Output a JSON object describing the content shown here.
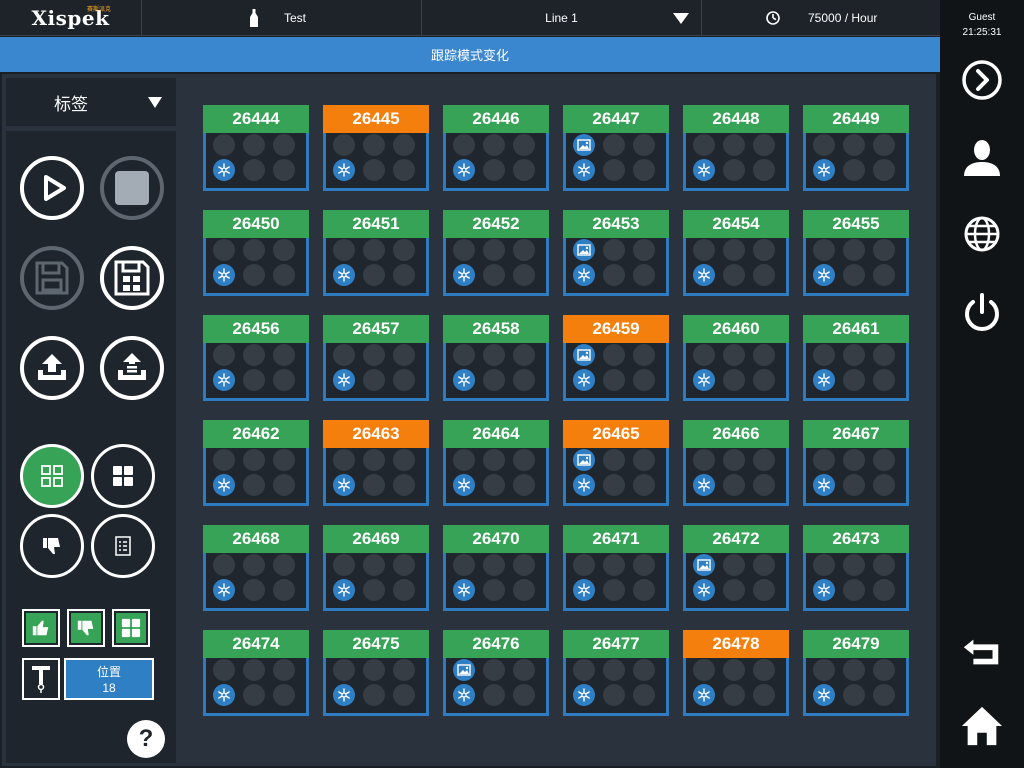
{
  "header": {
    "logo": "Xispek",
    "logo_sub": "赛斯派克",
    "product": "Test",
    "line": "Line 1",
    "speed": "75000 / Hour"
  },
  "banner": "跟踪模式变化",
  "user": {
    "name": "Guest",
    "time": "21:25:31"
  },
  "sidebar": {
    "dropdown_label": "标签",
    "position_label": "位置",
    "position_value": "18",
    "help": "?"
  },
  "colors": {
    "ok": "#36a356",
    "alarm": "#f57f0c",
    "accent": "#2f7fc5"
  },
  "tiles": [
    {
      "id": "26444",
      "alarm": false,
      "image": false
    },
    {
      "id": "26445",
      "alarm": true,
      "image": false
    },
    {
      "id": "26446",
      "alarm": false,
      "image": false
    },
    {
      "id": "26447",
      "alarm": false,
      "image": true
    },
    {
      "id": "26448",
      "alarm": false,
      "image": false
    },
    {
      "id": "26449",
      "alarm": false,
      "image": false
    },
    {
      "id": "26450",
      "alarm": false,
      "image": false
    },
    {
      "id": "26451",
      "alarm": false,
      "image": false
    },
    {
      "id": "26452",
      "alarm": false,
      "image": false
    },
    {
      "id": "26453",
      "alarm": false,
      "image": true
    },
    {
      "id": "26454",
      "alarm": false,
      "image": false
    },
    {
      "id": "26455",
      "alarm": false,
      "image": false
    },
    {
      "id": "26456",
      "alarm": false,
      "image": false
    },
    {
      "id": "26457",
      "alarm": false,
      "image": false
    },
    {
      "id": "26458",
      "alarm": false,
      "image": false
    },
    {
      "id": "26459",
      "alarm": true,
      "image": true
    },
    {
      "id": "26460",
      "alarm": false,
      "image": false
    },
    {
      "id": "26461",
      "alarm": false,
      "image": false
    },
    {
      "id": "26462",
      "alarm": false,
      "image": false
    },
    {
      "id": "26463",
      "alarm": true,
      "image": false
    },
    {
      "id": "26464",
      "alarm": false,
      "image": false
    },
    {
      "id": "26465",
      "alarm": true,
      "image": true
    },
    {
      "id": "26466",
      "alarm": false,
      "image": false
    },
    {
      "id": "26467",
      "alarm": false,
      "image": false
    },
    {
      "id": "26468",
      "alarm": false,
      "image": false
    },
    {
      "id": "26469",
      "alarm": false,
      "image": false
    },
    {
      "id": "26470",
      "alarm": false,
      "image": false
    },
    {
      "id": "26471",
      "alarm": false,
      "image": false
    },
    {
      "id": "26472",
      "alarm": false,
      "image": true
    },
    {
      "id": "26473",
      "alarm": false,
      "image": false
    },
    {
      "id": "26474",
      "alarm": false,
      "image": false
    },
    {
      "id": "26475",
      "alarm": false,
      "image": false
    },
    {
      "id": "26476",
      "alarm": false,
      "image": true
    },
    {
      "id": "26477",
      "alarm": false,
      "image": false
    },
    {
      "id": "26478",
      "alarm": true,
      "image": false
    },
    {
      "id": "26479",
      "alarm": false,
      "image": false
    }
  ]
}
